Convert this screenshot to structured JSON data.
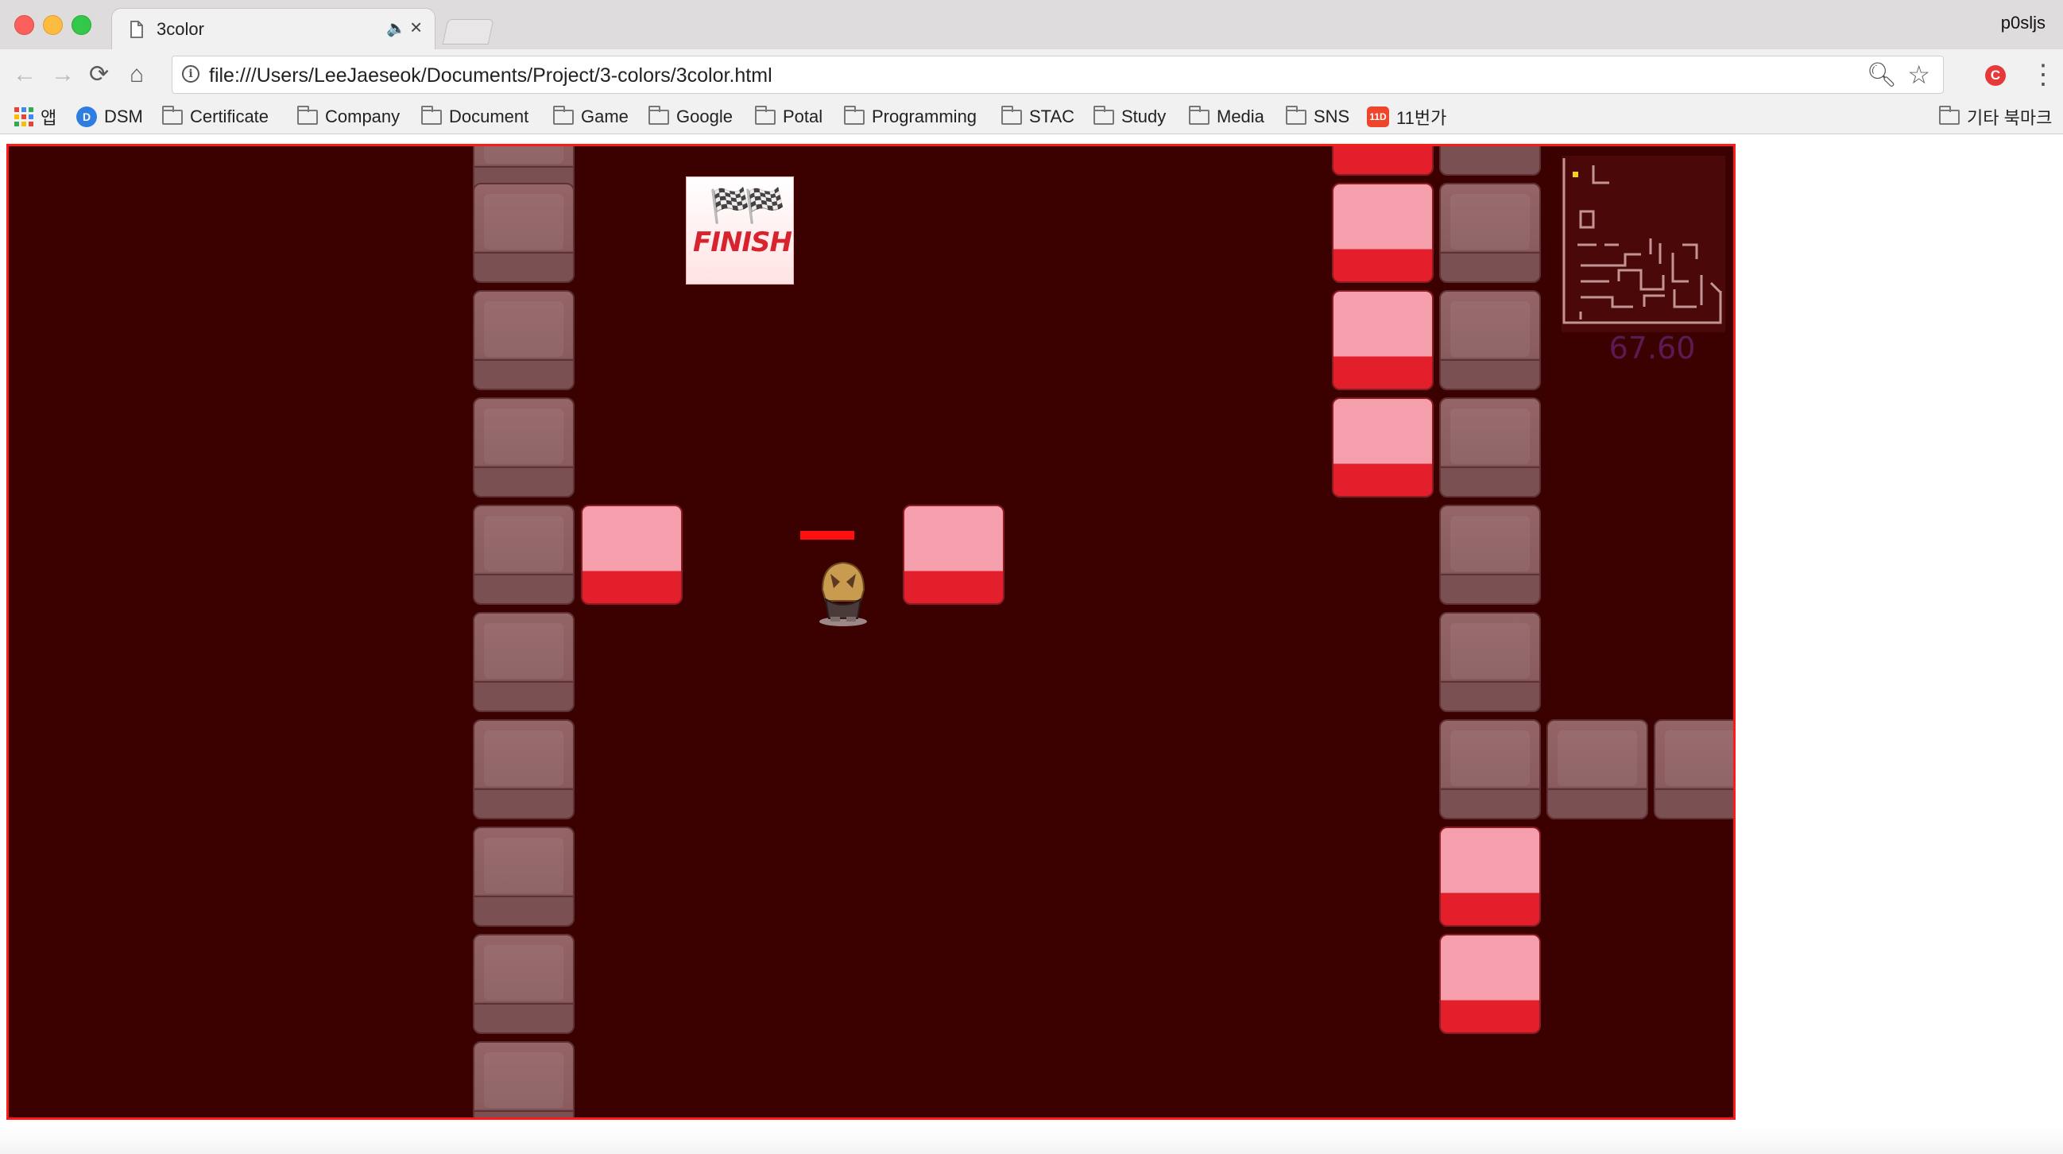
{
  "window": {
    "profile_name": "p0sljs"
  },
  "tab": {
    "title": "3color"
  },
  "toolbar": {
    "url": "file:///Users/LeeJaeseok/Documents/Project/3-colors/3color.html"
  },
  "bookmarks": {
    "apps_label": "앱",
    "items": [
      "DSM",
      "Certificate",
      "Company",
      "Document",
      "Game",
      "Google",
      "Potal",
      "Programming",
      "STAC",
      "Study",
      "Media",
      "SNS",
      "11번가"
    ],
    "other_label": "기타 북마크"
  },
  "game": {
    "finish_label": "FINISH",
    "timer": "67.60",
    "colors": {
      "background": "#3b0000",
      "border": "#ff1a1a",
      "pink_block": "#f69fac",
      "red_band": "#e21f2b",
      "gray_block": "#8a5c5e",
      "timer": "#5a1b55"
    }
  }
}
